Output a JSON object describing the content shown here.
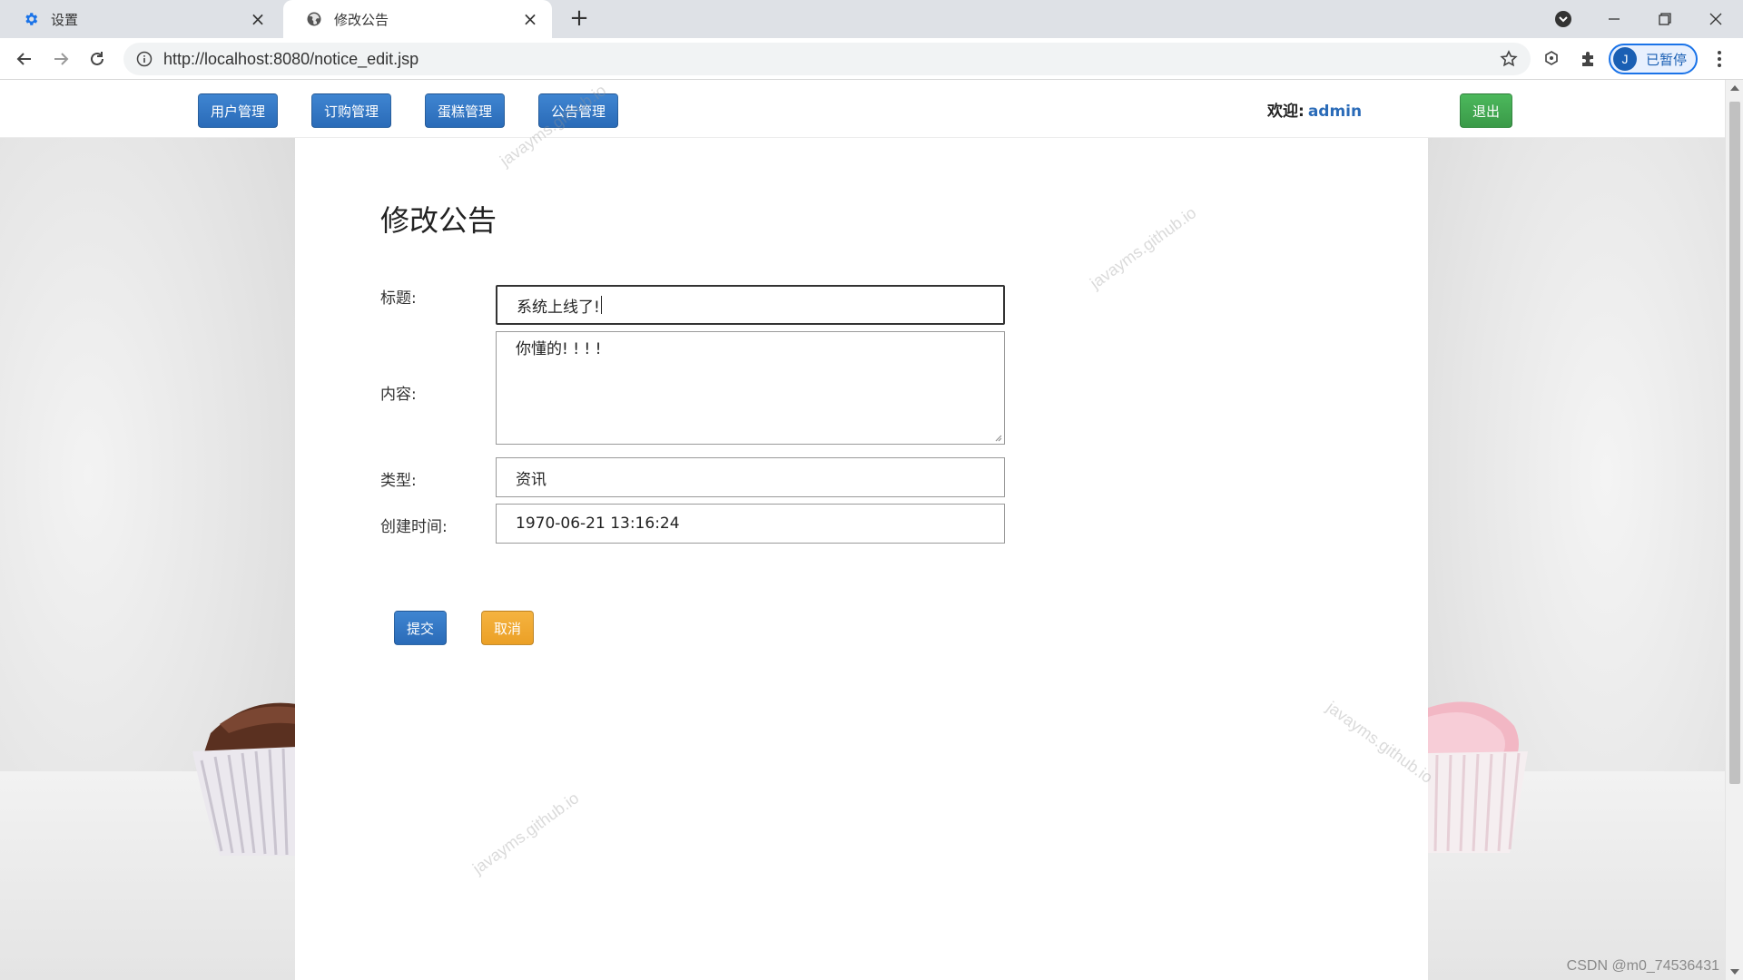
{
  "browser": {
    "tabs": [
      {
        "title": "设置",
        "icon": "gear-icon"
      },
      {
        "title": "修改公告",
        "icon": "globe-icon"
      }
    ],
    "url": "http://localhost:8080/notice_edit.jsp",
    "profile_initial": "J",
    "profile_label": "已暂停"
  },
  "nav": {
    "items": [
      "用户管理",
      "订购管理",
      "蛋糕管理",
      "公告管理"
    ],
    "welcome_label": "欢迎:",
    "username": "admin",
    "logout_label": "退出"
  },
  "form": {
    "title": "修改公告",
    "fields": {
      "title_label": "标题:",
      "title_value": "系统上线了! ",
      "content_label": "内容:",
      "content_value": "你懂的! ! ! !",
      "type_label": "类型:",
      "type_value": "资讯",
      "created_label": "创建时间:",
      "created_value": "1970-06-21 13:16:24"
    },
    "submit_label": "提交",
    "cancel_label": "取消"
  },
  "watermarks": [
    "javayms.github.io",
    "javayms.github.io",
    "javayms.github.io",
    "javayms.github.io"
  ],
  "footer_watermark": "CSDN @m0_74536431",
  "colors": {
    "primary_blue": "#2a6bb8",
    "success_green": "#3a9a48",
    "warning_orange": "#eba026"
  }
}
